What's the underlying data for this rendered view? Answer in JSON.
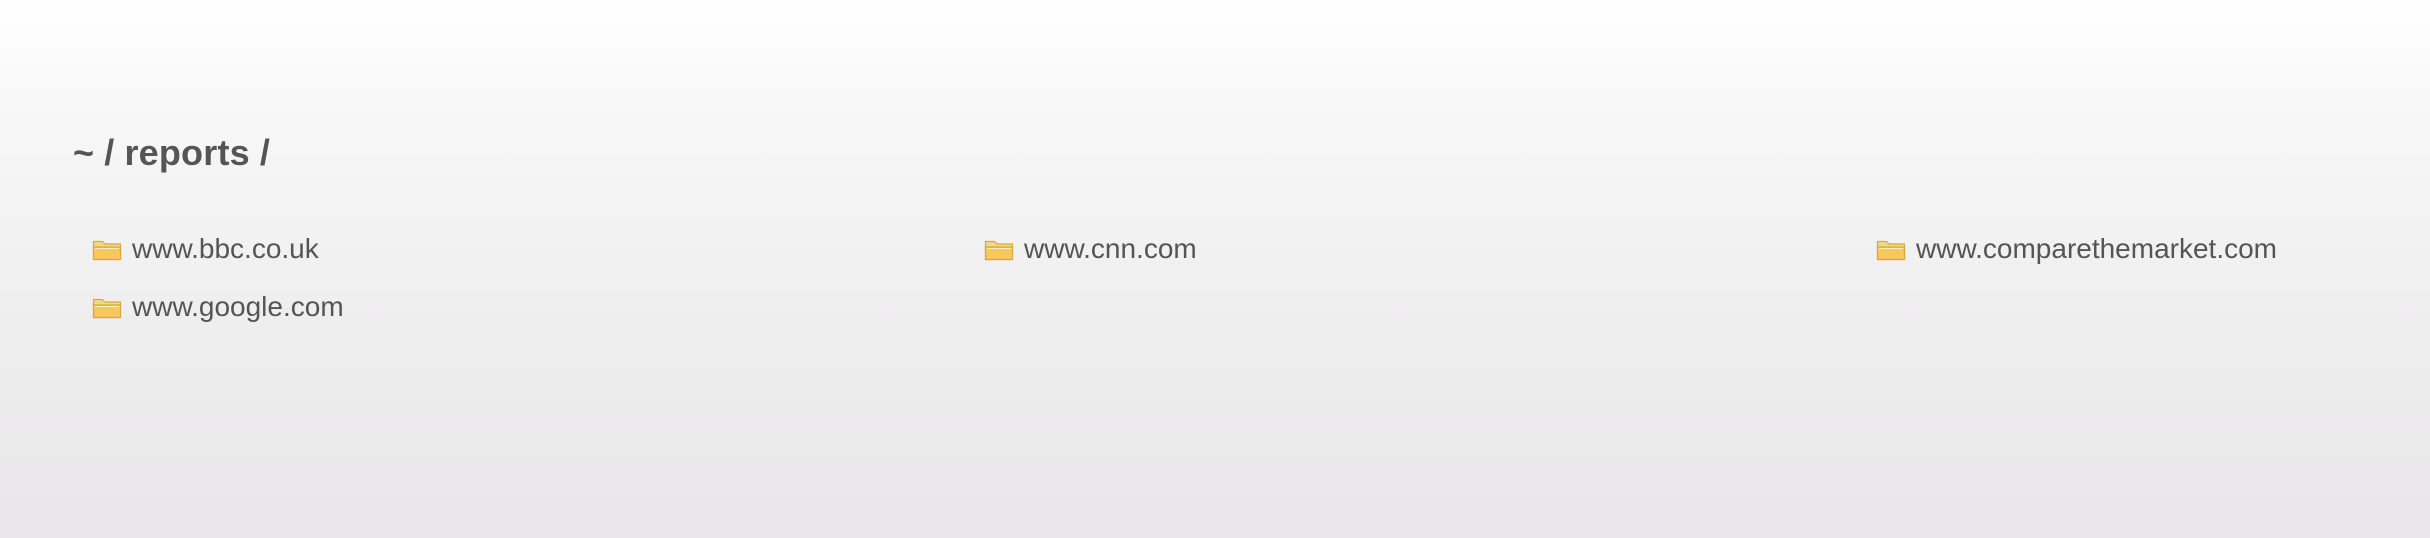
{
  "breadcrumb": {
    "home": "~",
    "separator": "/",
    "folder": "reports",
    "trailing_separator": "/"
  },
  "listing": {
    "items": [
      {
        "label": "www.bbc.co.uk",
        "icon": "folder-icon"
      },
      {
        "label": "www.cnn.com",
        "icon": "folder-icon"
      },
      {
        "label": "www.comparethemarket.com",
        "icon": "folder-icon"
      },
      {
        "label": "www.google.com",
        "icon": "folder-icon"
      }
    ]
  },
  "colors": {
    "text": "#555555",
    "background_top": "#ffffff",
    "background_bottom": "#e8e6e8",
    "folder_fill": "#f5cf6e",
    "folder_edge": "#d9a93a"
  }
}
